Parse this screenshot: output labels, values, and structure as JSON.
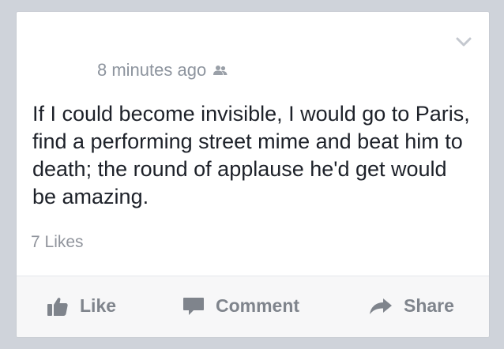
{
  "post": {
    "timestamp": "8 minutes ago",
    "audience_icon": "friends-icon",
    "text": "If I could become invisible, I would go to Paris, find a performing street mime and beat him to death; the round of applause he'd get would be amazing.",
    "likes": "7 Likes",
    "menu_icon": "chevron-down-icon"
  },
  "actions": {
    "like_label": "Like",
    "comment_label": "Comment",
    "share_label": "Share",
    "like_icon": "thumbs-up-icon",
    "comment_icon": "speech-bubble-icon",
    "share_icon": "share-arrow-icon"
  },
  "colors": {
    "background": "#cfd3da",
    "card": "#ffffff",
    "text_primary": "#1d2129",
    "text_secondary": "#8d949e",
    "action_text": "#7f848c"
  }
}
